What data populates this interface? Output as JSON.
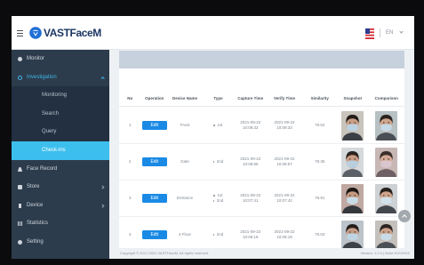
{
  "app": {
    "title": "VASTFaceM",
    "language": "EN",
    "menu_icon": "hamburger-icon",
    "logo_icon": "logo-icon",
    "flag_icon": "us-flag-icon"
  },
  "colors": {
    "accent": "#1a8ae5",
    "sidebar": "#2d3c4c",
    "submenu": "#223041",
    "active_item": "#3dbfee",
    "active_group_text": "#3cb6e6"
  },
  "sidebar": {
    "items": [
      {
        "label": "Monitor",
        "icon": "monitor-icon"
      },
      {
        "label": "Investigation",
        "icon": "investigation-icon",
        "chevron": "chevron-up-icon",
        "expanded": true
      },
      {
        "label": "Monitoring",
        "sub": true
      },
      {
        "label": "Search",
        "sub": true
      },
      {
        "label": "Query",
        "sub": true
      },
      {
        "label": "Check-ins",
        "sub": true,
        "active": true
      },
      {
        "label": "Face Record",
        "icon": "person-icon"
      },
      {
        "label": "Store",
        "icon": "store-icon",
        "chevron": "chevron-right-icon"
      },
      {
        "label": "Device",
        "icon": "device-icon",
        "chevron": "chevron-right-icon"
      },
      {
        "label": "Statistics",
        "icon": "chart-icon"
      },
      {
        "label": "Setting",
        "icon": "gear-icon"
      }
    ]
  },
  "main": {
    "table": {
      "headers": [
        "No",
        "Operation",
        "Device Name",
        "Type",
        "Capture Time",
        "Verify Time",
        "Similarity",
        "Snapshot",
        "Comparison"
      ],
      "rows": [
        {
          "no": "1",
          "action": "Edit",
          "device": "Front",
          "type": [
            "1st"
          ],
          "capture": [
            "2021-09-22",
            "10:09:32"
          ],
          "verify": [
            "2021-09-22",
            "10:09:33"
          ],
          "similarity": "79.52"
        },
        {
          "no": "2",
          "action": "Edit",
          "device": "Gate",
          "type": [
            "2nd"
          ],
          "capture": [
            "2021-09-22",
            "10:08:56"
          ],
          "verify": [
            "2021-09-22",
            "10:08:57"
          ],
          "similarity": "78.35"
        },
        {
          "no": "3",
          "action": "Edit",
          "device": "Entrance",
          "type": [
            "1st",
            "2nd"
          ],
          "capture": [
            "2021-09-22",
            "10:07:41"
          ],
          "verify": [
            "2021-09-22",
            "10:07:42"
          ],
          "similarity": "76.91"
        },
        {
          "no": "4",
          "action": "Edit",
          "device": "4 Floor",
          "type": [
            "2nd"
          ],
          "capture": [
            "2021-09-22",
            "10:06:18"
          ],
          "verify": [
            "2021-09-22",
            "10:06:19"
          ],
          "similarity": "75.03"
        }
      ]
    }
  },
  "footer": {
    "copyright": "Copyright © 2017-2021 VASTFaceM. All rights reserved.",
    "version": "Version: 1.0.0 | Build 20210922"
  }
}
